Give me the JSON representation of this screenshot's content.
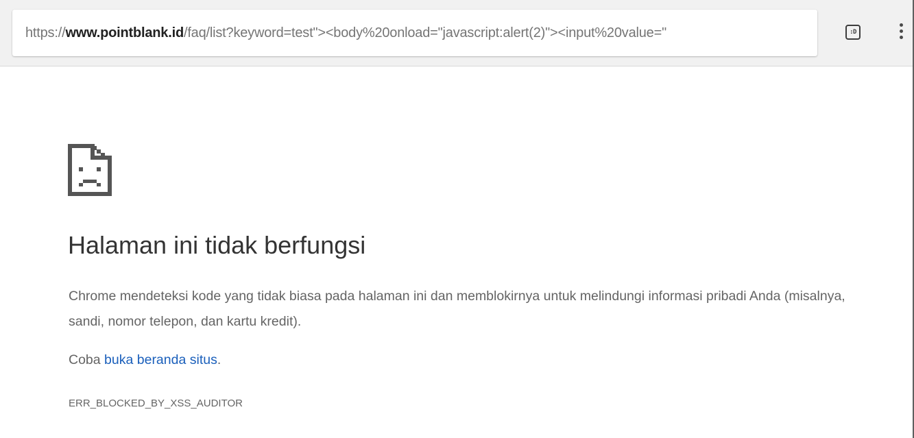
{
  "browser": {
    "url": {
      "scheme": "https://",
      "host": "www.pointblank.id",
      "path": "/faq/list?keyword=test\"><body%20onload=\"javascript:alert(2)\"><input%20value=\""
    },
    "extension_badge": ":D",
    "icons": [
      "extension-icon",
      "menu-kebab-icon"
    ]
  },
  "error_page": {
    "icon": "sad-page-icon",
    "title": "Halaman ini tidak berfungsi",
    "description": "Chrome mendeteksi kode yang tidak biasa pada halaman ini dan memblokirnya untuk melindungi informasi pribadi Anda (misalnya, sandi, nomor telepon, dan kartu kredit).",
    "try_prefix": "Coba ",
    "try_link": "buka beranda situs",
    "try_suffix": ".",
    "error_code": "ERR_BLOCKED_BY_XSS_AUDITOR"
  },
  "colors": {
    "link": "#1a5fbb",
    "title_text": "#333333",
    "body_text": "#646464",
    "toolbar_bg": "#f1f1f1"
  }
}
